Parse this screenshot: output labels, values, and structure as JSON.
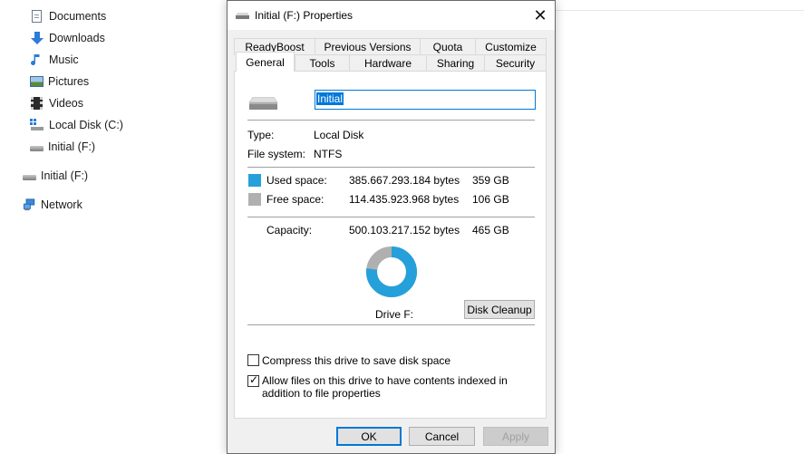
{
  "explorer": {
    "nav": [
      {
        "label": "Documents",
        "icon": "document-icon"
      },
      {
        "label": "Downloads",
        "icon": "download-arrow-icon"
      },
      {
        "label": "Music",
        "icon": "music-note-icon"
      },
      {
        "label": "Pictures",
        "icon": "pictures-icon"
      },
      {
        "label": "Videos",
        "icon": "film-icon"
      },
      {
        "label": "Local Disk (C:)",
        "icon": "windows-drive-icon"
      },
      {
        "label": "Initial (F:)",
        "icon": "drive-icon"
      },
      {
        "label": "Initial (F:)",
        "icon": "drive-icon"
      },
      {
        "label": "Network",
        "icon": "network-icon"
      }
    ]
  },
  "dialog": {
    "title": "Initial (F:) Properties",
    "tabs_row1": [
      "ReadyBoost",
      "Previous Versions",
      "Quota",
      "Customize"
    ],
    "tabs_row2": [
      "General",
      "Tools",
      "Hardware",
      "Sharing",
      "Security"
    ],
    "active_tab": "General",
    "drive_name_value": "Initial",
    "type_label": "Type:",
    "type_value": "Local Disk",
    "fs_label": "File system:",
    "fs_value": "NTFS",
    "used_label": "Used space:",
    "used_bytes": "385.667.293.184 bytes",
    "used_gb": "359 GB",
    "used_fraction": 0.771,
    "free_label": "Free space:",
    "free_bytes": "114.435.923.968 bytes",
    "free_gb": "106 GB",
    "capacity_label": "Capacity:",
    "capacity_bytes": "500.103.217.152 bytes",
    "capacity_gb": "465 GB",
    "drive_label": "Drive F:",
    "disk_cleanup": "Disk Cleanup",
    "compress_label": "Compress this drive to save disk space",
    "compress_checked": false,
    "index_label": "Allow files on this drive to have contents indexed in addition to file properties",
    "index_checked": true,
    "ok": "OK",
    "cancel": "Cancel",
    "apply": "Apply",
    "colors": {
      "used": "#26a0da",
      "free": "#b0b0b0",
      "accent": "#0078d7"
    }
  }
}
